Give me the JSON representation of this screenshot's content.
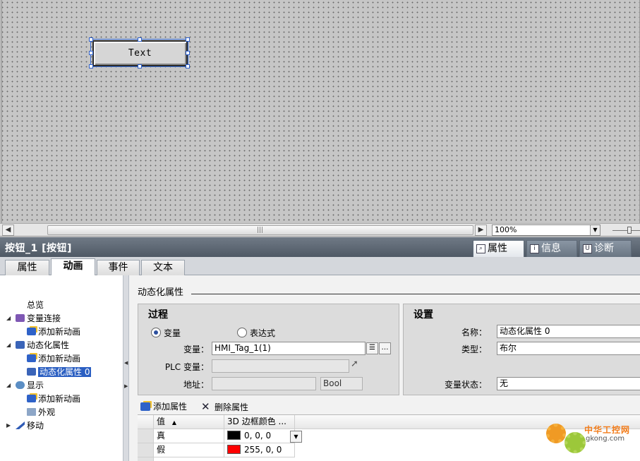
{
  "canvas": {
    "button_text": "Text"
  },
  "scrollbar": {
    "grip": "|||",
    "zoom": "100%"
  },
  "inspector": {
    "title": "按钮_1 [按钮]",
    "tabs": [
      "属性",
      "信息",
      "诊断"
    ]
  },
  "subtabs": [
    "属性",
    "动画",
    "事件",
    "文本"
  ],
  "tree": {
    "overview": "总览",
    "tag_connection": "变量连接",
    "add_animation": "添加新动画",
    "dynamize": "动态化属性",
    "dynamize_item": "动态化属性 0",
    "display": "显示",
    "appearance": "外观",
    "movement": "移动"
  },
  "panel": {
    "section_title": "动态化属性",
    "process": {
      "title": "过程",
      "radio_tag": "变量",
      "radio_expr": "表达式",
      "tag_label": "变量：",
      "tag_value": "HMI_Tag_1(1)",
      "plc_label": "PLC 变量：",
      "addr_label": "地址：",
      "addr_type": "Bool"
    },
    "settings": {
      "title": "设置",
      "name_label": "名称：",
      "name_value": "动态化属性 0",
      "type_label": "类型：",
      "type_value": "布尔",
      "state_label": "变量状态：",
      "state_value": "无"
    },
    "toolbar": {
      "add": "添加属性",
      "delete": "删除属性"
    },
    "grid": {
      "col_value": "值",
      "col_color": "3D 边框颜色 ...",
      "rows": [
        {
          "value": "真",
          "color": "0, 0, 0",
          "hex": "#000000"
        },
        {
          "value": "假",
          "color": "255, 0, 0",
          "hex": "#ff0000"
        }
      ]
    }
  },
  "watermark": {
    "brand": "中华工控网",
    "url": "gkong.com"
  }
}
